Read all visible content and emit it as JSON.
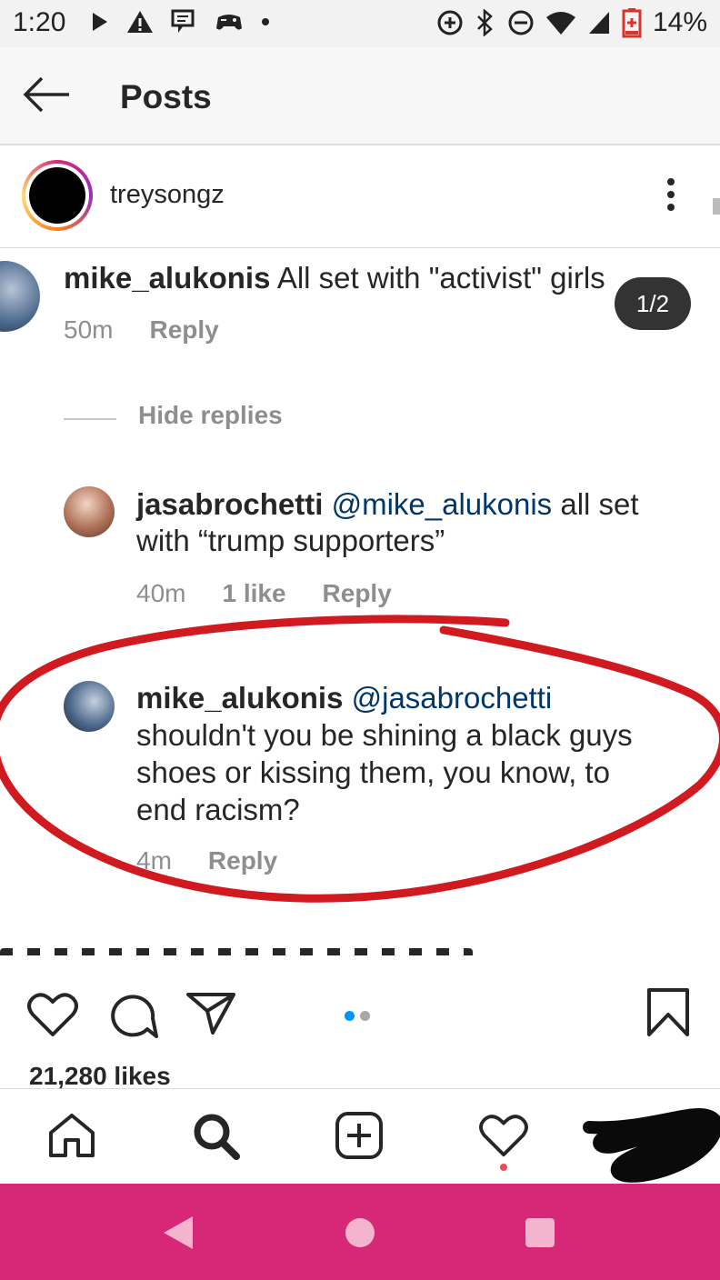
{
  "status_bar": {
    "time": "1:20",
    "battery": "14%",
    "icons": [
      "play-icon",
      "warning-icon",
      "message-icon",
      "gamepad-icon",
      "dot-icon",
      "data-saver-icon",
      "bluetooth-icon",
      "do-not-disturb-icon",
      "wifi-icon",
      "signal-icon",
      "battery-icon"
    ]
  },
  "header": {
    "title": "Posts"
  },
  "post": {
    "username": "treysongz",
    "image_counter": "1/2",
    "comment": {
      "username": "mike_alukonis",
      "text": "All set with \"activist\" girls",
      "time": "50m",
      "reply_label": "Reply"
    },
    "hide_replies_label": "Hide replies",
    "replies": [
      {
        "username": "jasabrochetti",
        "mention": "@mike_alukonis",
        "text": "all set with “trump supporters”",
        "time": "40m",
        "likes": "1 like",
        "reply_label": "Reply"
      },
      {
        "username": "mike_alukonis",
        "mention": "@jasabrochetti",
        "text": "shouldn't you be shining a black guys shoes or kissing them, you know, to end racism?",
        "time": "4m",
        "reply_label": "Reply"
      }
    ],
    "carousel_position": 1,
    "carousel_count": 2,
    "likes": "21,280 likes"
  },
  "colors": {
    "annotation_red": "#d11a1f",
    "carousel_active": "#0095f6",
    "nav_bar": "#d62876",
    "notification_dot": "#ed4956"
  }
}
